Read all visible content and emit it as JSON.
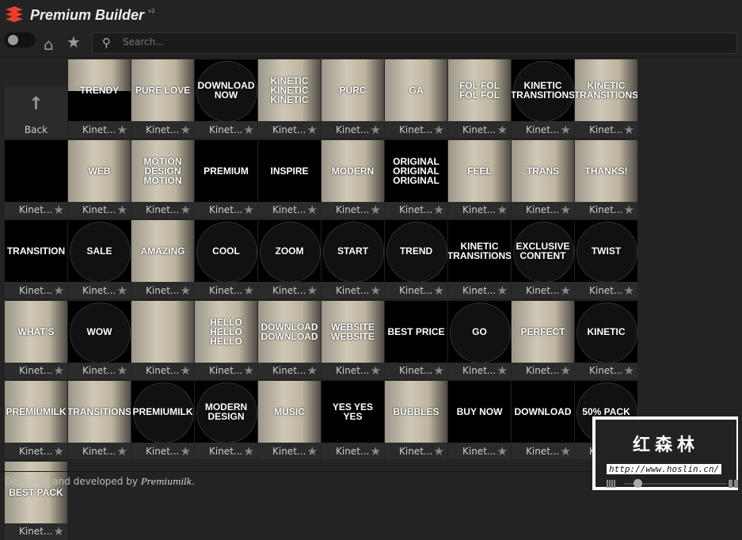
{
  "app": {
    "title": "Premium Builder",
    "version": "v2"
  },
  "toolbar": {
    "search_placeholder": "Search..."
  },
  "back_label": "Back",
  "tiles": [
    {
      "label": "Kinet...",
      "text": "TRENDY",
      "style": "photo half"
    },
    {
      "label": "Kinet...",
      "text": "PURE LOVE",
      "style": "photo"
    },
    {
      "label": "Kinet...",
      "text": "DOWNLOAD NOW",
      "style": "circle"
    },
    {
      "label": "Kinet...",
      "text": "KINETIC KINETIC KINETIC",
      "style": "photo"
    },
    {
      "label": "Kinet...",
      "text": "PURC",
      "style": "photo"
    },
    {
      "label": "Kinet...",
      "text": "GA",
      "style": "photo"
    },
    {
      "label": "Kinet...",
      "text": "FOL FOL FOL FOL",
      "style": "photo"
    },
    {
      "label": "Kinet...",
      "text": "KINETIC TRANSITIONS",
      "style": "circle"
    },
    {
      "label": "Kinet...",
      "text": "KINETIC TRANSITIONS",
      "style": "photo"
    },
    {
      "label": "Kinet...",
      "text": "",
      "style": ""
    },
    {
      "label": "Kinet...",
      "text": "WEB",
      "style": "photo"
    },
    {
      "label": "Kinet...",
      "text": "MOTION DESIGN MOTION",
      "style": "photo"
    },
    {
      "label": "Kinet...",
      "text": "PREMIUM",
      "style": ""
    },
    {
      "label": "Kinet...",
      "text": "INSPIRE",
      "style": ""
    },
    {
      "label": "Kinet...",
      "text": "MODERN",
      "style": "photo"
    },
    {
      "label": "Kinet...",
      "text": "ORIGINAL ORIGINAL ORIGINAL",
      "style": ""
    },
    {
      "label": "Kinet...",
      "text": "FEEL",
      "style": "photo"
    },
    {
      "label": "Kinet...",
      "text": "TRANS",
      "style": "photo"
    },
    {
      "label": "Kinet...",
      "text": "THANKS!",
      "style": "photo"
    },
    {
      "label": "Kinet...",
      "text": "TRANSITION",
      "style": ""
    },
    {
      "label": "Kinet...",
      "text": "SALE",
      "style": "circle"
    },
    {
      "label": "Kinet...",
      "text": "AMAZING",
      "style": "photo"
    },
    {
      "label": "Kinet...",
      "text": "COOL",
      "style": "circle"
    },
    {
      "label": "Kinet...",
      "text": "ZOOM",
      "style": "circle"
    },
    {
      "label": "Kinet...",
      "text": "START",
      "style": "circle"
    },
    {
      "label": "Kinet...",
      "text": "TREND",
      "style": "circle"
    },
    {
      "label": "Kinet...",
      "text": "KINETIC TRANSITIONS",
      "style": ""
    },
    {
      "label": "Kinet...",
      "text": "EXCLUSIVE CONTENT",
      "style": "circle"
    },
    {
      "label": "Kinet...",
      "text": "TWIST",
      "style": "circle"
    },
    {
      "label": "Kinet...",
      "text": "WHAT'S",
      "style": "photo"
    },
    {
      "label": "Kinet...",
      "text": "WOW",
      "style": "circle"
    },
    {
      "label": "Kinet...",
      "text": "",
      "style": "photo"
    },
    {
      "label": "Kinet...",
      "text": "HELLO HELLO HELLO",
      "style": "photo"
    },
    {
      "label": "Kinet...",
      "text": "DOWNLOAD DOWNLOAD",
      "style": "photo"
    },
    {
      "label": "Kinet...",
      "text": "WEBSITE WEBSITE",
      "style": "photo"
    },
    {
      "label": "Kinet...",
      "text": "BEST PRICE",
      "style": ""
    },
    {
      "label": "Kinet...",
      "text": "GO",
      "style": "circle"
    },
    {
      "label": "Kinet...",
      "text": "PERFECT",
      "style": "photo"
    },
    {
      "label": "Kinet...",
      "text": "KINETIC",
      "style": "circle"
    },
    {
      "label": "Kinet...",
      "text": "PREMIUMILK",
      "style": "photo"
    },
    {
      "label": "Kinet...",
      "text": "TRANSITIONS",
      "style": "photo"
    },
    {
      "label": "Kinet...",
      "text": "PREMIUMILK",
      "style": "circle"
    },
    {
      "label": "Kinet...",
      "text": "MODERN DESIGN",
      "style": "circle"
    },
    {
      "label": "Kinet...",
      "text": "MUSIC",
      "style": "photo"
    },
    {
      "label": "Kinet...",
      "text": "YES YES YES",
      "style": ""
    },
    {
      "label": "Kinet...",
      "text": "BUBBLES",
      "style": "photo"
    },
    {
      "label": "Kinet...",
      "text": "BUY NOW",
      "style": ""
    },
    {
      "label": "Kinet...",
      "text": "DOWNLOAD",
      "style": ""
    },
    {
      "label": "Kinet...",
      "text": "50% PACK",
      "style": "circle"
    },
    {
      "label": "Kinet...",
      "text": "BEST PACK",
      "style": "photo"
    }
  ],
  "footer": {
    "text": "Designed and developed by",
    "brand": "Premiumilk."
  },
  "watermark": {
    "name": "红森林",
    "url": "http://www.hoslin.cn/"
  }
}
